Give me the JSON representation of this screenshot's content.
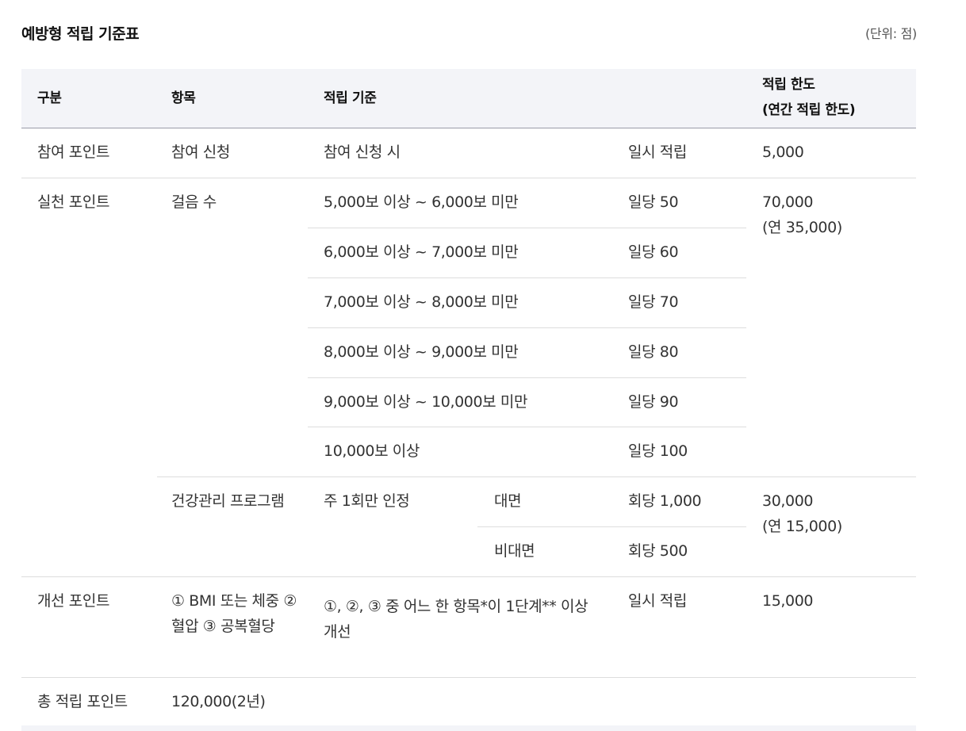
{
  "title": "예방형 적립 기준표",
  "unit": "(단위: 점)",
  "header": {
    "category": "구분",
    "item": "항목",
    "criteria": "적립 기준",
    "limit_line1": "적립 한도",
    "limit_line2": "(연간 적립 한도)"
  },
  "rows": {
    "participation": {
      "category": "참여 포인트",
      "item": "참여 신청",
      "criteria": "참여 신청 시",
      "points": "일시 적립",
      "limit": "5,000"
    },
    "practice": {
      "category": "실천 포인트",
      "steps": {
        "item": "걸음 수",
        "limit_line1": "70,000",
        "limit_line2": "(연 35,000)",
        "tiers": [
          {
            "criteria": "5,000보 이상 ~ 6,000보 미만",
            "points": "일당 50"
          },
          {
            "criteria": "6,000보 이상 ~ 7,000보 미만",
            "points": "일당 60"
          },
          {
            "criteria": "7,000보 이상 ~ 8,000보 미만",
            "points": "일당 70"
          },
          {
            "criteria": "8,000보 이상 ~ 9,000보 미만",
            "points": "일당 80"
          },
          {
            "criteria": "9,000보 이상 ~ 10,000보 미만",
            "points": "일당 90"
          },
          {
            "criteria": "10,000보 이상",
            "points": "일당 100"
          }
        ]
      },
      "program": {
        "item": "건강관리 프로그램",
        "criteria": "주 1회만 인정",
        "limit_line1": "30,000",
        "limit_line2": "(연 15,000)",
        "types": [
          {
            "type": "대면",
            "points": "회당 1,000"
          },
          {
            "type": "비대면",
            "points": "회당 500"
          }
        ]
      }
    },
    "improvement": {
      "category": "개선 포인트",
      "item": "① BMI 또는 체중 ② 혈압 ③ 공복혈당",
      "criteria": "①, ②, ③ 중 어느 한 항목*이 1단계** 이상 개선",
      "points": "일시 적립",
      "limit": "15,000"
    },
    "total": {
      "category": "총 적립 포인트",
      "value": "120,000(2년)"
    }
  }
}
